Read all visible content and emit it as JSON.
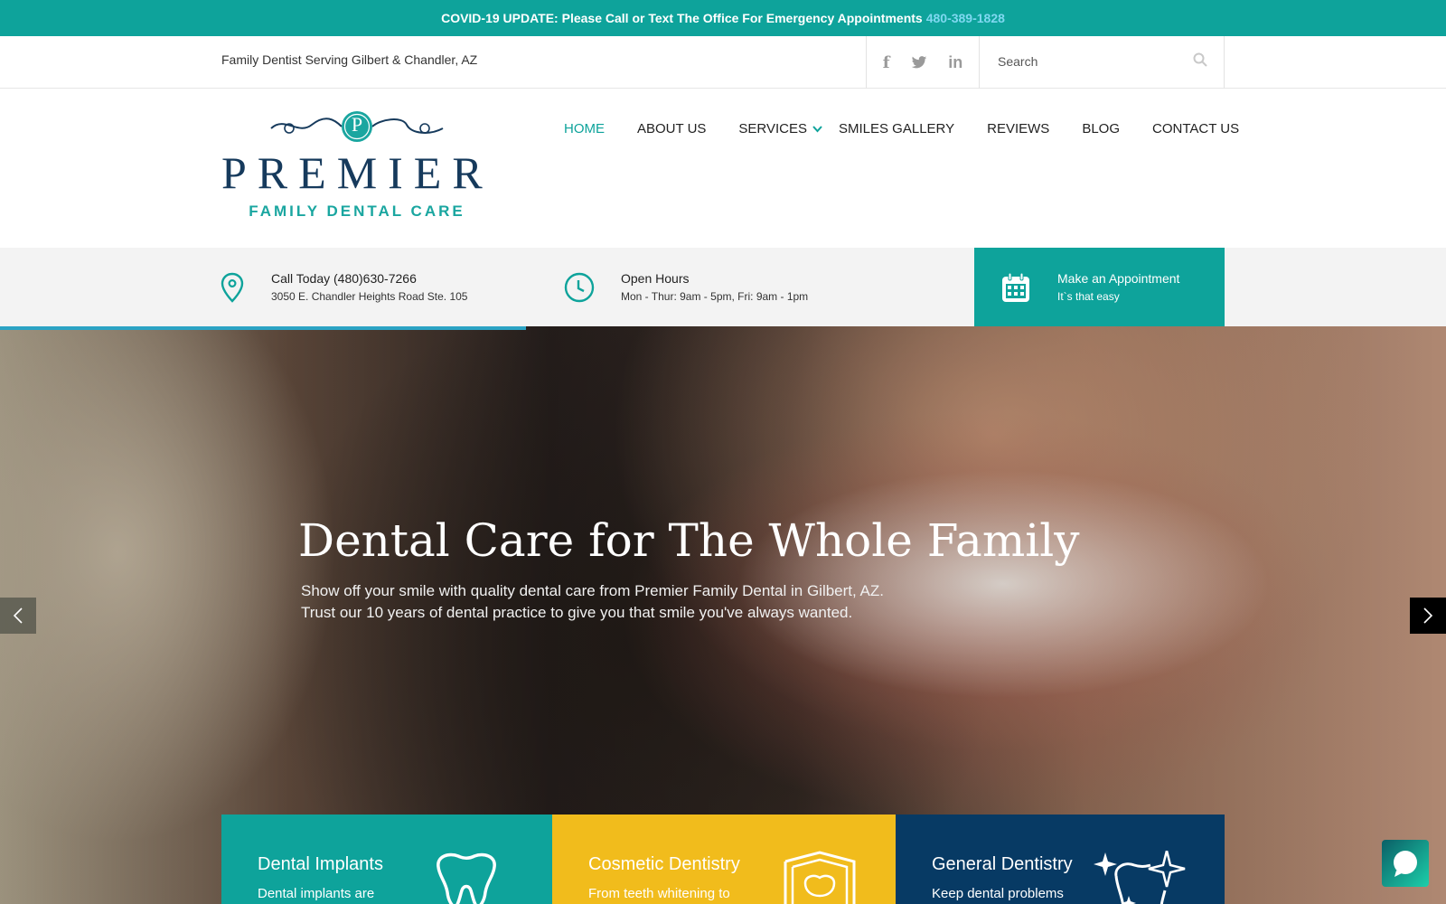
{
  "covid": {
    "message": "COVID-19 UPDATE: Please Call or Text The Office For Emergency Appointments",
    "phone": "480-389-1828"
  },
  "utility": {
    "tagline": "Family Dentist Serving Gilbert & Chandler, AZ",
    "social": {
      "facebook_glyph": "f",
      "linkedin_glyph": "in"
    },
    "search_placeholder": "Search"
  },
  "logo": {
    "crest_letter": "P",
    "name": "PREMIER",
    "subtitle": "FAMILY DENTAL CARE"
  },
  "nav": {
    "items": [
      {
        "label": "HOME",
        "active": true
      },
      {
        "label": "ABOUT US"
      },
      {
        "label": "SERVICES",
        "has_dropdown": true
      },
      {
        "label": "SMILES GALLERY"
      },
      {
        "label": "REVIEWS"
      },
      {
        "label": "BLOG"
      },
      {
        "label": "CONTACT US"
      }
    ]
  },
  "info": {
    "call": {
      "title": "Call Today (480)630-7266",
      "detail": "3050 E. Chandler Heights Road Ste. 105"
    },
    "hours": {
      "title": "Open Hours",
      "detail": "Mon - Thur: 9am - 5pm, Fri: 9am - 1pm"
    },
    "appointment": {
      "title": "Make an Appointment",
      "detail": "It`s that easy"
    }
  },
  "hero": {
    "heading": "Dental Care for The Whole Family",
    "subtext_line1": "Show off your smile with quality dental care from Premier Family Dental in Gilbert, AZ.",
    "subtext_line2": "Trust our 10 years of dental practice to give you that smile you've always wanted."
  },
  "cards": [
    {
      "title": "Dental Implants",
      "desc": "Dental implants are"
    },
    {
      "title": "Cosmetic Dentistry",
      "desc": "From teeth whitening to"
    },
    {
      "title": "General Dentistry",
      "desc": "Keep dental problems"
    }
  ],
  "colors": {
    "teal": "#0ea39b",
    "navy": "#073a64",
    "yellow": "#f1bc1c",
    "progress": "#2ba3c4"
  }
}
